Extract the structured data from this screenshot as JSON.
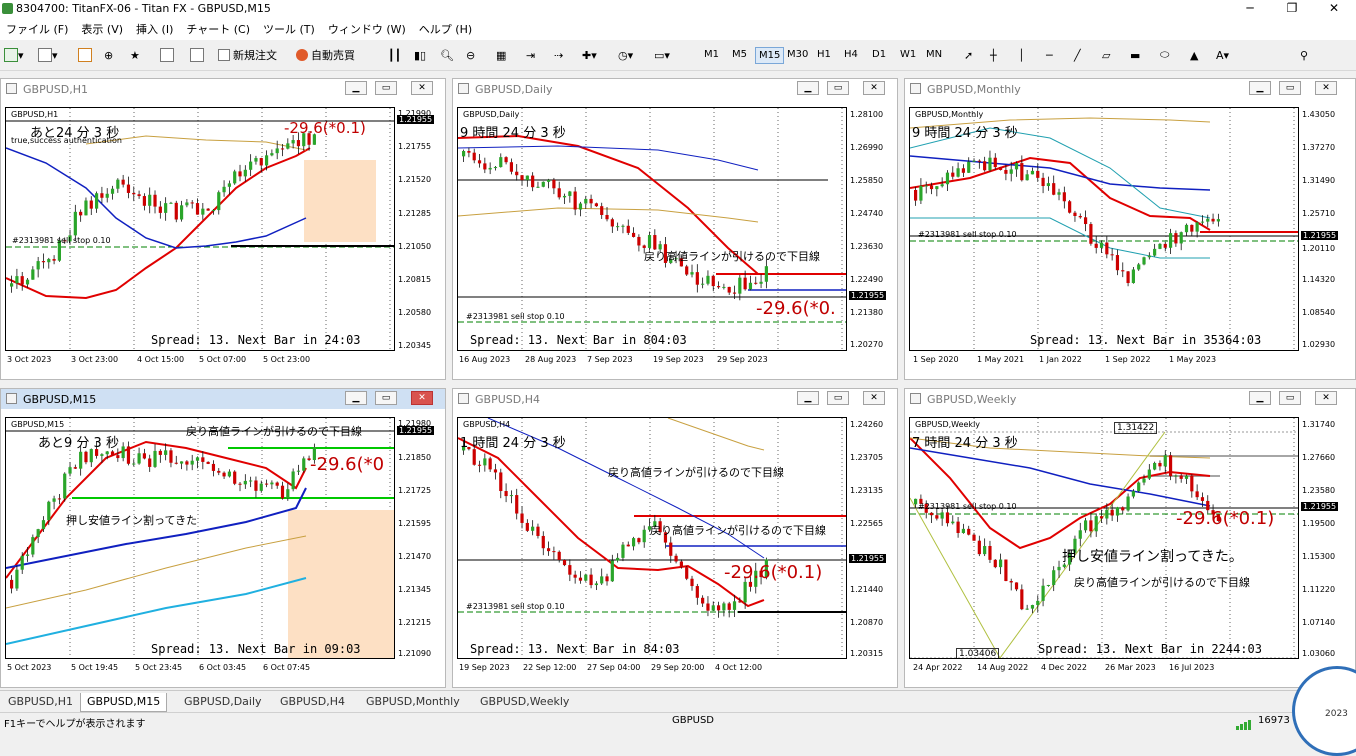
{
  "window_title": "8304700: TitanFX-06 - Titan FX - GBPUSD,M15",
  "menu": [
    "ファイル (F)",
    "表示 (V)",
    "挿入 (I)",
    "チャート (C)",
    "ツール (T)",
    "ウィンドウ (W)",
    "ヘルプ (H)"
  ],
  "toolbar": {
    "new_order": "新規注文",
    "auto_trading": "自動売買",
    "timeframes": [
      "M1",
      "M5",
      "M15",
      "M30",
      "H1",
      "H4",
      "D1",
      "W1",
      "MN"
    ],
    "selected_tf": "M15",
    "notifications": "1"
  },
  "charts": [
    {
      "id": "h1",
      "title": "GBPUSD,H1",
      "symbol": "GBPUSD,H1",
      "countdown": "あと24 分 3 秒",
      "sub": "true,success authentication",
      "order_label": "#2313981 sell stop 0.10",
      "spread": "Spread: 13. Next Bar in 24:03",
      "value_label": "-29.6(*0.1)",
      "y_labels": [
        "1.21990",
        "1.21755",
        "1.21520",
        "1.21285",
        "1.21050",
        "1.20815",
        "1.20580",
        "1.20345"
      ],
      "current_price": "1.21955",
      "x_labels": [
        "3 Oct 2023",
        "3 Oct 23:00",
        "4 Oct 15:00",
        "5 Oct 07:00",
        "5 Oct 23:00"
      ]
    },
    {
      "id": "daily",
      "title": "GBPUSD,Daily",
      "symbol": "GBPUSD,Daily",
      "countdown": "9 時間 24 分 3 秒",
      "order_label": "#2313981 sell stop 0.10",
      "spread": "Spread: 13. Next Bar in 804:03",
      "annotation": "戻り高値ラインが引けるので下目線",
      "value_label": "-29.6(*0.",
      "y_labels": [
        "1.28100",
        "1.26990",
        "1.25850",
        "1.24740",
        "1.23630",
        "1.22490",
        "1.21380",
        "1.20270"
      ],
      "current_price": "1.21955",
      "x_labels": [
        "16 Aug 2023",
        "28 Aug 2023",
        "7 Sep 2023",
        "19 Sep 2023",
        "29 Sep 2023"
      ]
    },
    {
      "id": "monthly",
      "title": "GBPUSD,Monthly",
      "symbol": "GBPUSD,Monthly",
      "countdown": "9 時間 24 分 3 秒",
      "order_label": "#2313981 sell stop 0.10",
      "spread": "Spread: 13. Next Bar in 35364:03",
      "y_labels": [
        "1.43050",
        "1.37270",
        "1.31490",
        "1.25710",
        "1.20110",
        "1.14320",
        "1.08540",
        "1.02930"
      ],
      "current_price": "1.21955",
      "x_labels": [
        "1 Sep 2020",
        "1 May 2021",
        "1 Jan 2022",
        "1 Sep 2022",
        "1 May 2023"
      ]
    },
    {
      "id": "m15",
      "title": "GBPUSD,M15",
      "symbol": "GBPUSD,M15",
      "countdown": "あと9 分 3 秒",
      "order_label": "",
      "spread": "Spread: 13. Next Bar in 09:03",
      "annotation": "戻り高値ラインが引けるので下目線",
      "annotation2": "押し安値ライン割ってきた",
      "value_label": "-29.6(*0",
      "y_labels": [
        "1.21980",
        "1.21850",
        "1.21725",
        "1.21595",
        "1.21470",
        "1.21345",
        "1.21215",
        "1.21090"
      ],
      "current_price": "1.21955",
      "x_labels": [
        "5 Oct 2023",
        "5 Oct 19:45",
        "5 Oct 23:45",
        "6 Oct 03:45",
        "6 Oct 07:45"
      ]
    },
    {
      "id": "h4",
      "title": "GBPUSD,H4",
      "symbol": "GBPUSD,H4",
      "countdown": "1 時間 24 分 3 秒",
      "order_label": "#2313981 sell stop 0.10",
      "spread": "Spread: 13. Next Bar in 84:03",
      "annotation": "戻り高値ラインが引けるので下目線",
      "annotation2": "戻り高値ラインが引けるので下目線",
      "value_label": "-29.6(*0.1)",
      "y_labels": [
        "1.24260",
        "1.23705",
        "1.23135",
        "1.22565",
        "1.21955",
        "1.21440",
        "1.20870",
        "1.20315"
      ],
      "current_price": "1.21955",
      "x_labels": [
        "19 Sep 2023",
        "22 Sep 12:00",
        "27 Sep 04:00",
        "29 Sep 20:00",
        "4 Oct 12:00"
      ]
    },
    {
      "id": "weekly",
      "title": "GBPUSD,Weekly",
      "symbol": "GBPUSD,Weekly",
      "countdown": "7 時間 24 分 3 秒",
      "order_label": "#2313981 sell stop 0.10",
      "spread": "Spread: 13. Next Bar in 2244:03",
      "annotation": "押し安値ライン割ってきた。",
      "annotation2": "戻り高値ラインが引けるので下目線",
      "value_label": "-29.6(*0.1)",
      "high_label": "1.31422",
      "low_label": "1.03406",
      "y_labels": [
        "1.31740",
        "1.27660",
        "1.23580",
        "1.19500",
        "1.15300",
        "1.11220",
        "1.07140",
        "1.03060"
      ],
      "current_price": "1.21955",
      "x_labels": [
        "24 Apr 2022",
        "14 Aug 2022",
        "4 Dec 2022",
        "26 Mar 2023",
        "16 Jul 2023"
      ]
    }
  ],
  "tabs": [
    "GBPUSD,H1",
    "GBPUSD,M15",
    "GBPUSD,Daily",
    "GBPUSD,H4",
    "GBPUSD,Monthly",
    "GBPUSD,Weekly"
  ],
  "selected_tab": "GBPUSD,M15",
  "status": {
    "help": "F1キーでヘルプが表示されます",
    "symbol": "GBPUSD",
    "traffic": "16973",
    "clock_year": "2023"
  },
  "colors": {
    "ma_red": "#e00000",
    "ma_blue": "#1020c0",
    "ma_gold": "#c8a040",
    "ma_cyan": "#20b0e0",
    "bull": "#2aa52a",
    "bear": "#cc0000",
    "zone": "#fde0c4",
    "green_line": "#00c800"
  }
}
